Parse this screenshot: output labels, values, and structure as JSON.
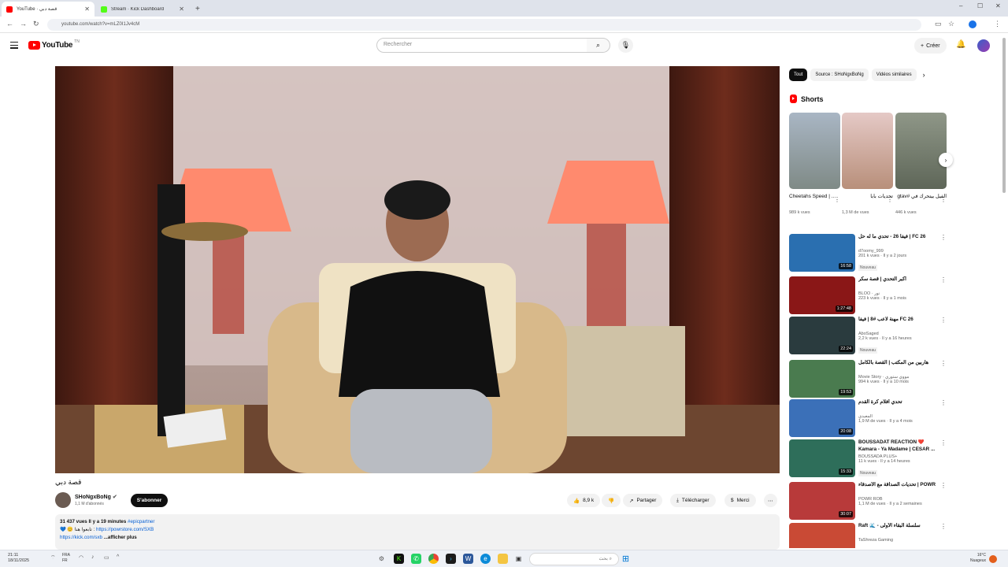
{
  "browser": {
    "tabs": [
      {
        "title": "YouTube · قصة دبي",
        "active": true
      },
      {
        "title": "Stream · Kick Dashboard",
        "active": false
      }
    ],
    "url": "youtube.com/watch?v=mLZ0I1Jv4cM"
  },
  "masthead": {
    "logo_text": "YouTube",
    "region": "TN",
    "search_placeholder": "Rechercher",
    "create_label": "Créer"
  },
  "video": {
    "title": "قصة دبي",
    "channel": "SHoNgxBoNg",
    "subscribers": "1,1 M d'abonnés",
    "subscribe_label": "S'abonner",
    "likes": "8,9 k",
    "share_label": "Partager",
    "download_label": "Télécharger",
    "thanks_label": "Merci",
    "description": {
      "stats": "31 437 vues  Il y a 19 minutes",
      "hashtag": "#epicpartner",
      "line2_prefix": "💙 😊 تابعوا هنا :",
      "line2_link": "https://powrstore.com/SXB",
      "line3_link": "https://kick.com/sxb",
      "more": "...afficher plus"
    }
  },
  "sidebar": {
    "chips": [
      "Tout",
      "Source : SHoNgxBoNg",
      "Vidéos similaires"
    ],
    "shorts_title": "Shorts",
    "shorts": [
      {
        "title": "Cheetahs Speed | ...",
        "views": "989 k vues",
        "color": "#8b9bb0"
      },
      {
        "title": "تحديات بابا",
        "views": "1,3 M de vues",
        "color": "#d9b8a3"
      },
      {
        "title": "الفيل بيتحرك في #gtav",
        "views": "446 k vues",
        "color": "#7e8a78"
      }
    ],
    "recommendations": [
      {
        "title": "فيفا 26 - تحدي ما له حل | FC 26",
        "channel": "d7oomy_999",
        "views": "201 k vues · Il y a 2 jours",
        "badge": "Nouveau",
        "duration": "16:58",
        "color": "#2a6fb0"
      },
      {
        "title": "أكبر التحدي | قصة سكر",
        "channel": "BLOO · نور",
        "views": "223 k vues · Il y a 1 mois",
        "badge": "",
        "duration": "1:27:48",
        "color": "#8a1717"
      },
      {
        "title": "مهنة لاعب #8 | فيفا FC 26",
        "channel": "AboSaged",
        "views": "2,2 k vues · Il y a 16 heures",
        "badge": "Nouveau",
        "duration": "22:24",
        "color": "#2a3b3e"
      },
      {
        "title": "هاربين من المكتب | القصة بالكامل",
        "channel": "Movie Story · مووي ستوري",
        "views": "994 k vues · Il y a 10 mois",
        "badge": "",
        "duration": "19:53",
        "color": "#4a7b4f"
      },
      {
        "title": "تحدي أفلام كرة القدم",
        "channel": "المعيدي",
        "views": "1,9 M de vues · Il y a 4 mois",
        "badge": "",
        "duration": "20:08",
        "color": "#3b70b8"
      },
      {
        "title": "BOUSSADAT REACTION ❤️ Kamara - Ya Madame | CESAR ...",
        "channel": "BOUSSADA PLUS+",
        "views": "11 k vues · Il y a 14 heures",
        "badge": "Nouveau",
        "duration": "15:33",
        "color": "#2e6e5a"
      },
      {
        "title": "تحديات الصداقة مع الأصدقاء | POWR",
        "channel": "POWR ROB",
        "views": "1,1 M de vues · Il y a 2 semaines",
        "badge": "",
        "duration": "30:07",
        "color": "#b83a3a"
      },
      {
        "title": "Raft 🌊 - سلسلة البقاء الأولى",
        "channel": "TaShreza Gaming",
        "views": "",
        "badge": "",
        "duration": "",
        "color": "#c94a35"
      }
    ]
  },
  "taskbar": {
    "time": "21:11",
    "date": "18/11/2025",
    "lang": "FRA\nFR",
    "search_placeholder": "بحث",
    "weather": "16°C\nNuageux"
  }
}
